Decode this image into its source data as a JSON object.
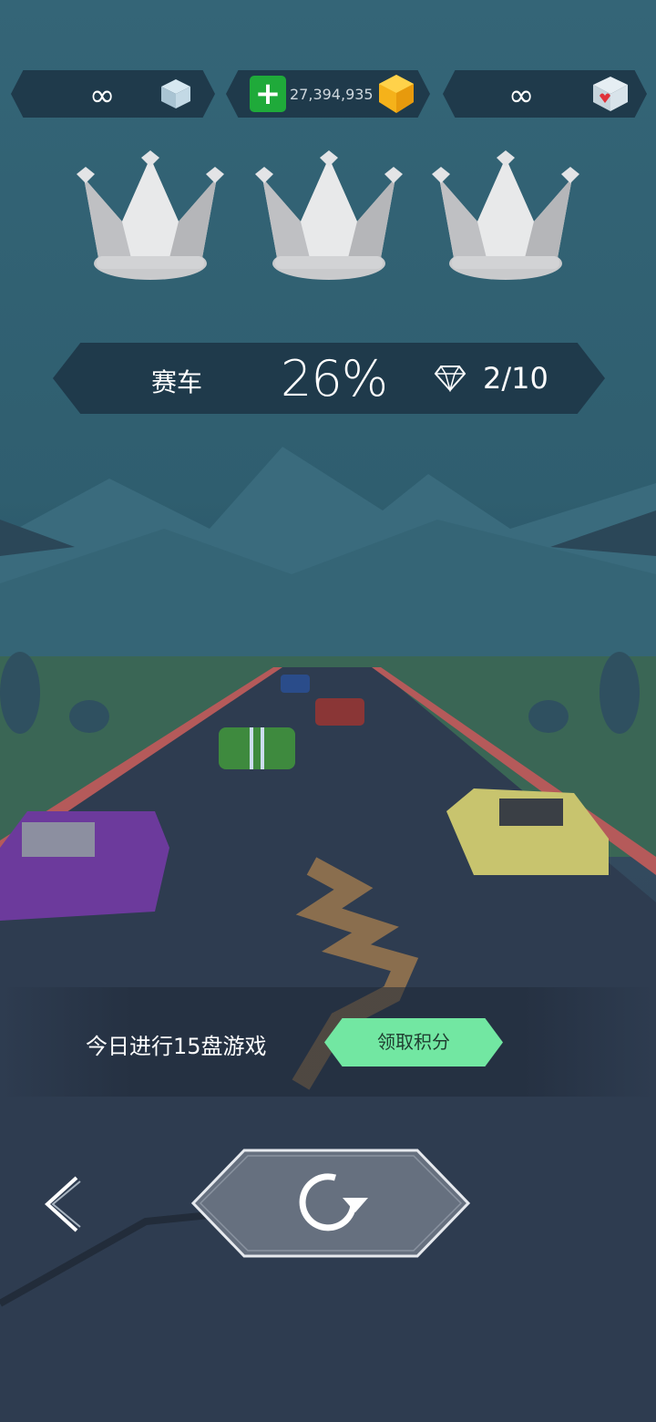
{
  "top_bar": {
    "left_value": "∞",
    "coins": "27,394,935",
    "plus_symbol": "+",
    "right_value": "∞"
  },
  "crowns": [
    {
      "name": "crown-1",
      "color": "#d9dadc"
    },
    {
      "name": "crown-2",
      "color": "#d9dadc"
    },
    {
      "name": "crown-3",
      "color": "#d9dadc"
    }
  ],
  "info": {
    "mode": "赛车",
    "percent": "26%",
    "gems": "2/10"
  },
  "daily": {
    "text": "今日进行15盘游戏",
    "claim_label": "领取积分"
  },
  "colors": {
    "accent_green": "#72e7a2",
    "plus_green": "#1faa3a",
    "coin_yellow": "#f5b21a"
  }
}
